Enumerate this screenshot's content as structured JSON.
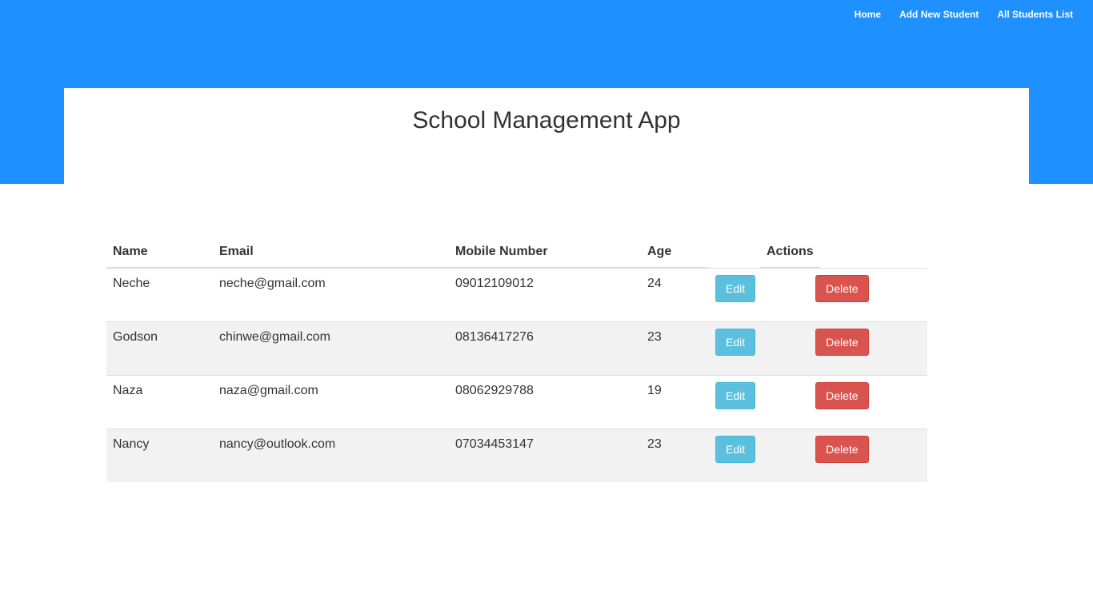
{
  "nav": {
    "home": "Home",
    "add_new_student": "Add New Student",
    "all_students_list": "All Students List"
  },
  "header": {
    "title": "School Management App"
  },
  "table": {
    "columns": {
      "name": "Name",
      "email": "Email",
      "mobile": "Mobile Number",
      "age": "Age",
      "actions": "Actions"
    },
    "rows": [
      {
        "name": "Neche",
        "email": "neche@gmail.com",
        "mobile": "09012109012",
        "age": "24"
      },
      {
        "name": "Godson",
        "email": "chinwe@gmail.com",
        "mobile": "08136417276",
        "age": "23"
      },
      {
        "name": "Naza",
        "email": "naza@gmail.com",
        "mobile": "08062929788",
        "age": "19"
      },
      {
        "name": "Nancy",
        "email": "nancy@outlook.com",
        "mobile": "07034453147",
        "age": "23"
      }
    ],
    "edit_label": "Edit",
    "delete_label": "Delete"
  },
  "colors": {
    "header_blue": "#1e90ff",
    "edit_button": "#5bc0de",
    "delete_button": "#d9534f",
    "stripe": "#f2f2f2"
  }
}
